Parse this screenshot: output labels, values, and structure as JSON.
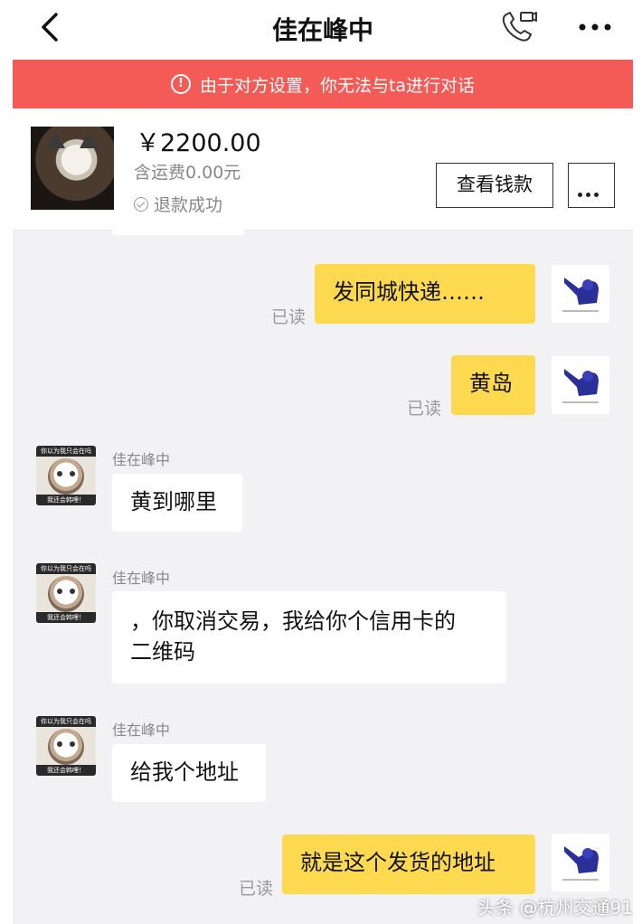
{
  "header": {
    "title": "佳在峰中",
    "back_icon": "chevron-left-icon",
    "call_icon": "phone-icon",
    "more_icon": "more-dots-icon"
  },
  "banner": {
    "text": "由于对方设置，你无法与ta进行对话",
    "icon": "info-icon",
    "color": "#f45a56"
  },
  "product": {
    "price": "￥2200.00",
    "shipping": "含运费0.00元",
    "status": "退款成功",
    "view_button": "查看钱款"
  },
  "messages": [
    {
      "side": "me",
      "text": "发同城快递……",
      "read": "已读"
    },
    {
      "side": "me",
      "text": "黄岛",
      "read": "已读"
    },
    {
      "side": "them",
      "sender": "佳在峰中",
      "text": "黄到哪里"
    },
    {
      "side": "them",
      "sender": "佳在峰中",
      "line1": "，你取消交易，我给你个信用卡的",
      "line2": "二维码"
    },
    {
      "side": "them",
      "sender": "佳在峰中",
      "text": "给我个地址"
    },
    {
      "side": "me",
      "text": "就是这个发货的地址",
      "read": "已读"
    }
  ],
  "avatar_caption": {
    "top": "你以为我只会在吗",
    "bottom": "我还会韩哩！"
  },
  "watermark": "头条 @杭州交通91.8",
  "colors": {
    "my_bubble": "#fcd94f",
    "their_bubble": "#ffffff",
    "background": "#f2f2f4"
  }
}
